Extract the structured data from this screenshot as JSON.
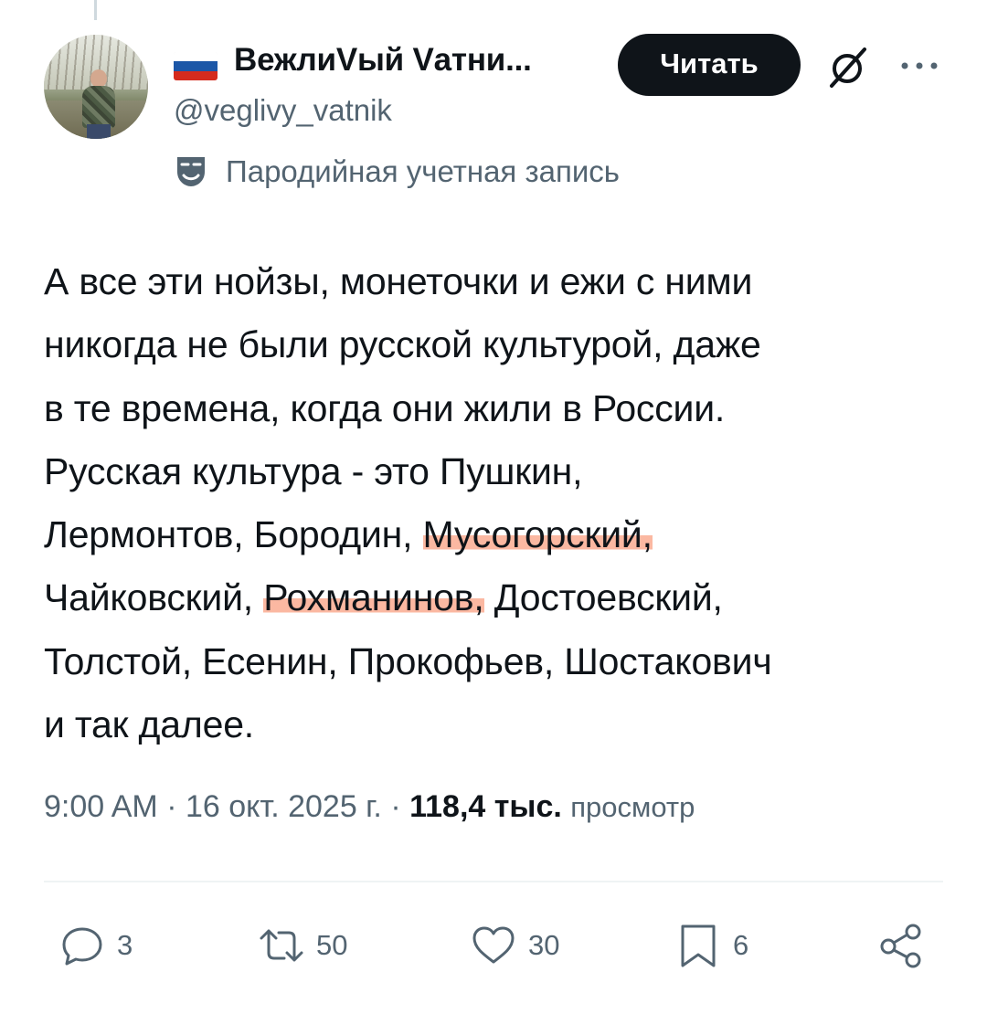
{
  "author": {
    "flag": {
      "colors": [
        "#ffffff",
        "#1c57a7",
        "#d52b1e"
      ]
    },
    "display_name": "ВежлиVый Vатни...",
    "handle": "@veglivy_vatnik",
    "parody_label": "Пародийная учетная запись"
  },
  "header": {
    "follow_label": "Читать"
  },
  "tweet": {
    "lines": [
      {
        "pre": "А все эти нойзы, монеточки и ежи с ними",
        "hl": "",
        "post": ""
      },
      {
        "pre": "никогда не были русской культурой, даже",
        "hl": "",
        "post": ""
      },
      {
        "pre": "в те времена, когда они жили в России.",
        "hl": "",
        "post": ""
      },
      {
        "pre": "Русская культура - это Пушкин,",
        "hl": "",
        "post": ""
      },
      {
        "pre": "Лермонтов, Бородин, ",
        "hl": "Мусогорский,",
        "post": ""
      },
      {
        "pre": "Чайковский, ",
        "hl": "Рохманинов,",
        "post": " Достоевский,"
      },
      {
        "pre": "Толстой, Есенин, Прокофьев, Шостакович",
        "hl": "",
        "post": ""
      },
      {
        "pre": "и так далее.",
        "hl": "",
        "post": ""
      }
    ]
  },
  "meta": {
    "time": "9:00 AM",
    "separator": " · ",
    "date": "16 окт. 2025 г.",
    "views_count": "118,4 тыс.",
    "views_label": "просмотр"
  },
  "actions": {
    "replies": "3",
    "reposts": "50",
    "likes": "30",
    "bookmarks": "6"
  },
  "colors": {
    "text": "#0f1419",
    "secondary": "#536471",
    "highlight": "#faa082"
  }
}
